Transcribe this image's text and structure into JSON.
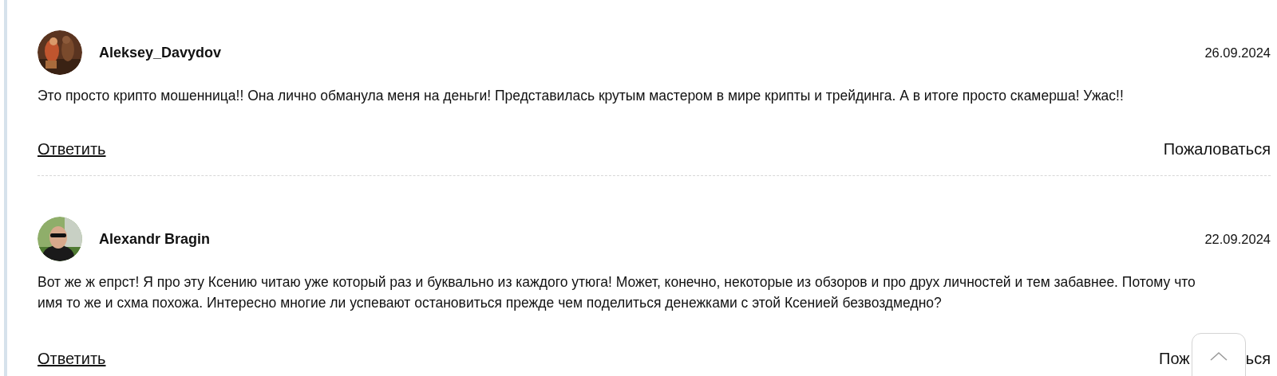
{
  "comments": [
    {
      "author": "Aleksey_Davydov",
      "date": "26.09.2024",
      "text": "Это просто крипто мошенница!! Она лично обманула меня на деньги! Представилась крутым мастером в мире крипты и трейдинга. А в итоге просто скамерша! Ужас!!",
      "reply": "Ответить",
      "report": [
        "Пожаловаться"
      ],
      "avatar": {
        "kind": "picture"
      }
    },
    {
      "author": "Alexandr Bragin",
      "date": "22.09.2024",
      "text": "Вот же ж епрст! Я про эту Ксению читаю уже который раз и буквально из каждого утюга! Может, конечно, некоторые из обзоров и про друх личностей и тем забавнее. Потому что имя то же и схма похожа. Интересно многие ли успевают остановиться прежде чем поделиться денежками с этой Ксенией безвоздмедно?",
      "reply": "Ответить",
      "report": [
        "Пож",
        "ься"
      ],
      "avatar": {
        "kind": "picture"
      }
    }
  ]
}
